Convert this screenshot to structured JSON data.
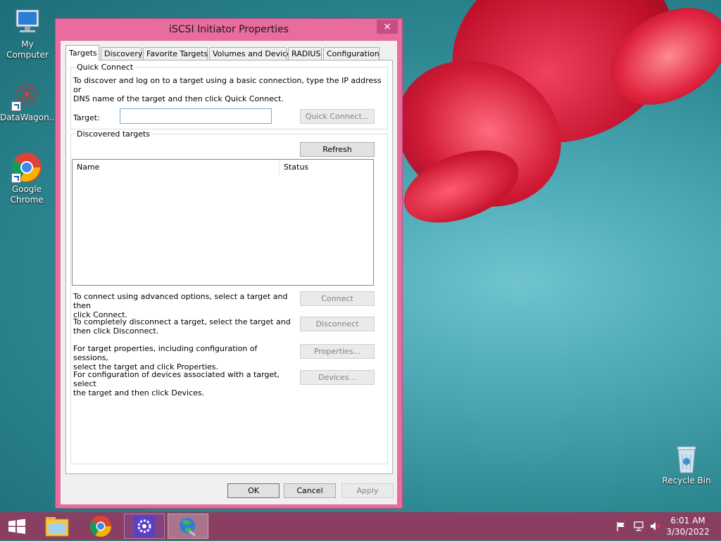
{
  "desktop": {
    "icons": [
      {
        "label": "My Computer",
        "icon": "computer-icon"
      },
      {
        "label": "DataWagon...",
        "icon": "datawagon-icon"
      },
      {
        "label": "Google Chrome",
        "icon": "chrome-icon"
      },
      {
        "label": "Recycle Bin",
        "icon": "recycle-bin-icon"
      }
    ]
  },
  "dialog": {
    "title": "iSCSI Initiator Properties",
    "close_icon": "×",
    "tabs": [
      {
        "label": "Targets",
        "active": true
      },
      {
        "label": "Discovery"
      },
      {
        "label": "Favorite Targets"
      },
      {
        "label": "Volumes and Devices"
      },
      {
        "label": "RADIUS"
      },
      {
        "label": "Configuration"
      }
    ],
    "quick_connect": {
      "group_label": "Quick Connect",
      "description_line1": "To discover and log on to a target using a basic connection, type the IP address or",
      "description_line2": "DNS name of the target and then click Quick Connect.",
      "target_label": "Target:",
      "target_value": "",
      "quick_connect_button": "Quick Connect..."
    },
    "discovered": {
      "group_label": "Discovered targets",
      "refresh_button": "Refresh",
      "columns": [
        "Name",
        "Status"
      ],
      "rows": []
    },
    "actions": [
      {
        "line1": "To connect using advanced options, select a target and then",
        "line2": "click Connect.",
        "button": "Connect"
      },
      {
        "line1": "To completely disconnect a target, select the target and",
        "line2": "then click Disconnect.",
        "button": "Disconnect"
      },
      {
        "line1": "For target properties, including configuration of sessions,",
        "line2": "select the target and click Properties.",
        "button": "Properties..."
      },
      {
        "line1": "For configuration of devices associated with a target, select",
        "line2": "the target and then click Devices.",
        "button": "Devices..."
      }
    ],
    "footer": {
      "ok": "OK",
      "cancel": "Cancel",
      "apply": "Apply"
    }
  },
  "taskbar": {
    "items": [
      "start-icon",
      "file-explorer-icon",
      "chrome-icon",
      "settings-icon",
      "iscsi-initiator-icon"
    ],
    "clock_time": "6:01 AM",
    "clock_date": "3/30/2022",
    "colors": {
      "taskbar": "#8a3f62",
      "window_frame": "#e86c9d",
      "close_button": "#c74e83"
    }
  }
}
